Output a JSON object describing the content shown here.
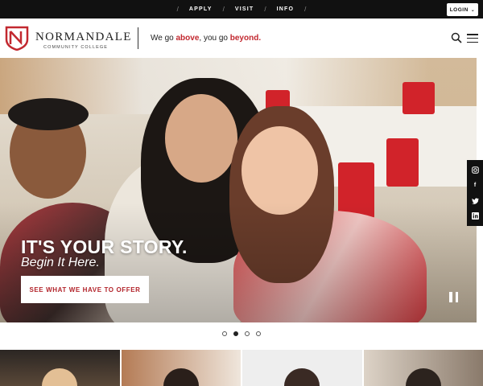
{
  "topnav": {
    "links": [
      "APPLY",
      "VISIT",
      "INFO"
    ],
    "separator": "/",
    "login_label": "LOGIN",
    "login_icon": "chevron-down-icon"
  },
  "header": {
    "logo_name": "Normandale",
    "logo_subtitle": "COMMUNITY COLLEGE",
    "tagline_pre": "We go ",
    "tagline_word1": "above",
    "tagline_mid": ", you go ",
    "tagline_word2": "beyond",
    "tagline_end": ".",
    "search_icon": "search-icon",
    "menu_icon": "hamburger-menu-icon"
  },
  "hero": {
    "title": "IT'S YOUR STORY.",
    "subtitle": "Begin It Here.",
    "cta_label": "SEE WHAT WE HAVE TO OFFER",
    "pause_icon": "pause-icon"
  },
  "social": {
    "icons": [
      "instagram-icon",
      "facebook-icon",
      "twitter-icon",
      "linkedin-icon"
    ],
    "glyphs": [
      "◎",
      "f",
      "🐦",
      "in"
    ]
  },
  "carousel": {
    "slide_count": 4,
    "active_index": 1
  },
  "colors": {
    "brand_red": "#c2282f",
    "topbar_bg": "#111111"
  }
}
